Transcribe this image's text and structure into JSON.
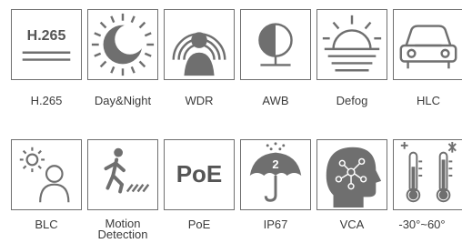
{
  "row1": [
    {
      "label": "H.265",
      "icon": "h265-icon",
      "icon_text": "H.265"
    },
    {
      "label": "Day&Night",
      "icon": "day-night-icon"
    },
    {
      "label": "WDR",
      "icon": "wdr-icon"
    },
    {
      "label": "AWB",
      "icon": "awb-icon"
    },
    {
      "label": "Defog",
      "icon": "defog-icon"
    },
    {
      "label": "HLC",
      "icon": "hlc-car-icon"
    }
  ],
  "row2": [
    {
      "label": "BLC",
      "icon": "blc-icon"
    },
    {
      "label": "Motion Detection",
      "icon": "motion-detection-icon"
    },
    {
      "label": "PoE",
      "icon": "poe-icon",
      "icon_text": "PoE"
    },
    {
      "label": "IP67",
      "icon": "ip67-umbrella-icon",
      "icon_text": "2"
    },
    {
      "label": "VCA",
      "icon": "vca-head-icon"
    },
    {
      "label": "-30°~60°",
      "icon": "temperature-range-icon"
    }
  ],
  "colors": {
    "icon_gray": "#6f6f6f",
    "text": "#3a3a3a"
  }
}
